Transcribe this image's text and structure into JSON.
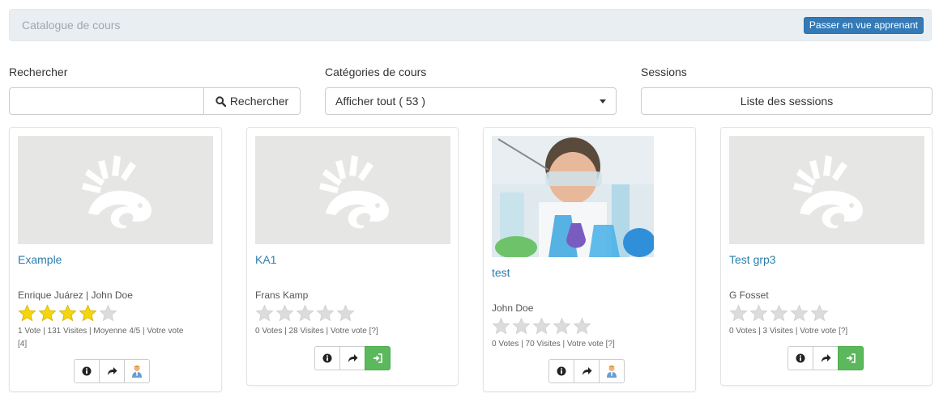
{
  "header": {
    "title": "Catalogue de cours",
    "learner_view_button": "Passer en vue apprenant"
  },
  "filters": {
    "search_label": "Rechercher",
    "search_placeholder": "",
    "search_button": "Rechercher",
    "categories_label": "Catégories de cours",
    "categories_selected": "Afficher tout ( 53 )",
    "sessions_label": "Sessions",
    "sessions_button": "Liste des sessions"
  },
  "courses": [
    {
      "title": "Example",
      "teachers": "Enrique Juárez | John Doe",
      "rating": 4,
      "max_rating": 5,
      "stats": "1 Vote | 131 Visites | Moyenne 4/5 | Votre vote",
      "stats_line2": "[4]",
      "image": "placeholder",
      "actions": [
        "info-icon",
        "share-icon",
        "teacher-icon"
      ]
    },
    {
      "title": "KA1",
      "teachers": "Frans Kamp",
      "rating": 0,
      "max_rating": 5,
      "stats": "0 Votes | 28 Visites | Votre vote [?]",
      "image": "placeholder",
      "actions": [
        "info-icon",
        "share-icon",
        "enter-icon"
      ]
    },
    {
      "title": "test",
      "teachers": "John Doe",
      "rating": 0,
      "max_rating": 5,
      "stats": "0 Votes | 70 Visites | Votre vote [?]",
      "image": "lab-photo",
      "actions": [
        "info-icon",
        "share-icon",
        "teacher-icon"
      ]
    },
    {
      "title": "Test grp3",
      "teachers": "G Fosset",
      "rating": 0,
      "max_rating": 5,
      "stats": "0 Votes | 3 Visites | Votre vote [?]",
      "image": "placeholder",
      "actions": [
        "info-icon",
        "share-icon",
        "enter-icon"
      ]
    }
  ],
  "colors": {
    "primary": "#337ab7",
    "link": "#2a7fae",
    "success": "#5cb85c",
    "star_filled": "#f5d60a",
    "star_empty": "#dcdcdc",
    "header_bg": "#e9eef3"
  }
}
